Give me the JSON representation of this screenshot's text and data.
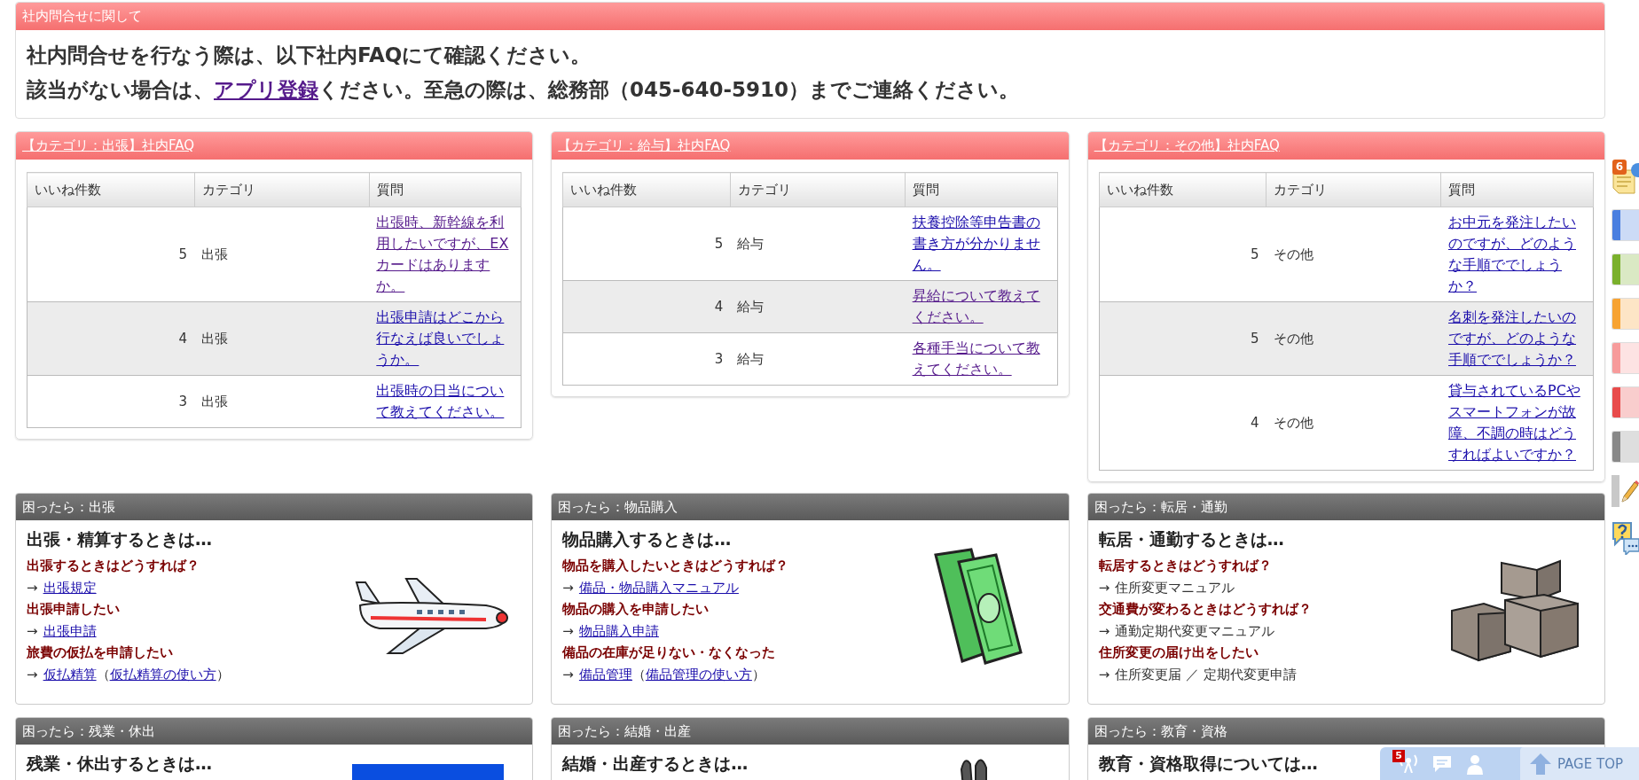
{
  "notice": {
    "title": "社内問合せに関して",
    "line_1": "社内問合せを行なう際は、以下社内FAQにて確認ください。",
    "line_2": {
      "before": "該当がない場合は、",
      "link": "アプリ登録",
      "link_visited": true,
      "after": "ください。至急の際は、総務部（045-640-5910）までご連絡ください。"
    }
  },
  "faq_cards": [
    {
      "title": "【カテゴリ：出張】社内FAQ",
      "columns": [
        "いいね件数",
        "カテゴリ",
        "質問"
      ],
      "rows": [
        {
          "likes": "5",
          "category": "出張",
          "question": "出張時、新幹線を利用したいですが、EXカードはありますか。",
          "visited": true
        },
        {
          "likes": "4",
          "category": "出張",
          "question": "出張申請はどこから行なえば良いでしょうか。",
          "visited": false
        },
        {
          "likes": "3",
          "category": "出張",
          "question": "出張時の日当について教えてください。",
          "visited": false
        }
      ]
    },
    {
      "title": "【カテゴリ：給与】社内FAQ",
      "columns": [
        "いいね件数",
        "カテゴリ",
        "質問"
      ],
      "rows": [
        {
          "likes": "5",
          "category": "給与",
          "question": "扶養控除等申告書の書き方が分かりません。",
          "visited": false
        },
        {
          "likes": "4",
          "category": "給与",
          "question": "昇給について教えてください。",
          "visited": true
        },
        {
          "likes": "3",
          "category": "給与",
          "question": "各種手当について教えてください。",
          "visited": true
        }
      ]
    },
    {
      "title": "【カテゴリ：その他】社内FAQ",
      "columns": [
        "いいね件数",
        "カテゴリ",
        "質問"
      ],
      "rows": [
        {
          "likes": "5",
          "category": "その他",
          "question": "お中元を発注したいのですが、どのような手順ででしょうか？",
          "visited": false
        },
        {
          "likes": "5",
          "category": "その他",
          "question": "名刺を発注したいのですが、どのような手順ででしょうか？",
          "visited": false
        },
        {
          "likes": "4",
          "category": "その他",
          "question": "貸与されているPCやスマートフォンが故障、不調の時はどうすればよいですか？",
          "visited": false
        }
      ]
    }
  ],
  "help_cards": [
    {
      "title": "困ったら：出張",
      "heading": "出張・精算するときは…",
      "lines": [
        {
          "kind": "question",
          "text": "出張するときはどうすれば？"
        },
        {
          "kind": "answer",
          "arrow": "→",
          "parts": [
            {
              "text": "出張規定",
              "link": true
            }
          ]
        },
        {
          "kind": "question",
          "text": "出張申請したい"
        },
        {
          "kind": "answer",
          "arrow": "→",
          "parts": [
            {
              "text": "出張申請",
              "link": true
            }
          ]
        },
        {
          "kind": "question",
          "text": "旅費の仮払を申請したい"
        },
        {
          "kind": "answer",
          "arrow": "→",
          "parts": [
            {
              "text": "仮払精算",
              "link": true
            },
            {
              "text": "（",
              "link": false
            },
            {
              "text": "仮払精算の使い方",
              "link": true
            },
            {
              "text": "）",
              "link": false
            }
          ]
        }
      ]
    },
    {
      "title": "困ったら：物品購入",
      "heading": "物品購入するときは…",
      "lines": [
        {
          "kind": "question",
          "text": "物品を購入したいときはどうすれば？"
        },
        {
          "kind": "answer",
          "arrow": "→",
          "parts": [
            {
              "text": "備品・物品購入マニュアル",
              "link": true
            }
          ]
        },
        {
          "kind": "question",
          "text": "物品の購入を申請したい"
        },
        {
          "kind": "answer",
          "arrow": "→",
          "parts": [
            {
              "text": "物品購入申請",
              "link": true
            }
          ]
        },
        {
          "kind": "question",
          "text": "備品の在庫が足りない・なくなった"
        },
        {
          "kind": "answer",
          "arrow": "→",
          "parts": [
            {
              "text": "備品管理",
              "link": true
            },
            {
              "text": "（",
              "link": false
            },
            {
              "text": "備品管理の使い方",
              "link": true
            },
            {
              "text": "）",
              "link": false
            }
          ]
        }
      ]
    },
    {
      "title": "困ったら：転居・通勤",
      "heading": "転居・通勤するときは…",
      "lines": [
        {
          "kind": "question",
          "text": "転居するときはどうすれば？"
        },
        {
          "kind": "answer",
          "arrow": "→",
          "parts": [
            {
              "text": "住所変更マニュアル",
              "link": false
            }
          ]
        },
        {
          "kind": "question",
          "text": "交通費が変わるときはどうすれば？"
        },
        {
          "kind": "answer",
          "arrow": "→",
          "parts": [
            {
              "text": "通勤定期代変更マニュアル",
              "link": false
            }
          ]
        },
        {
          "kind": "question",
          "text": "住所変更の届け出をしたい"
        },
        {
          "kind": "answer",
          "arrow": "→",
          "parts": [
            {
              "text": "住所変更届 ／ 定期代変更申請",
              "link": false
            }
          ]
        }
      ]
    },
    {
      "title": "困ったら：残業・休出",
      "heading": "残業・休出するときは…"
    },
    {
      "title": "困ったら：結婚・出産",
      "heading": "結婚・出産するときは…"
    },
    {
      "title": "困ったら：教育・資格",
      "heading": "教育・資格取得については…"
    }
  ],
  "side_tabs": [
    {
      "kind": "notes",
      "badge": "6"
    },
    {
      "kind": "color",
      "color": "#4a7fe0"
    },
    {
      "kind": "color",
      "color": "#7ab02c"
    },
    {
      "kind": "color",
      "color": "#f7a332"
    },
    {
      "kind": "color",
      "color": "#f79b9b"
    },
    {
      "kind": "color",
      "color": "#e84b4b"
    },
    {
      "kind": "color",
      "color": "#888888"
    },
    {
      "kind": "pencil"
    },
    {
      "kind": "help"
    }
  ],
  "page_top": {
    "badge": "5",
    "label": "PAGE TOP"
  }
}
